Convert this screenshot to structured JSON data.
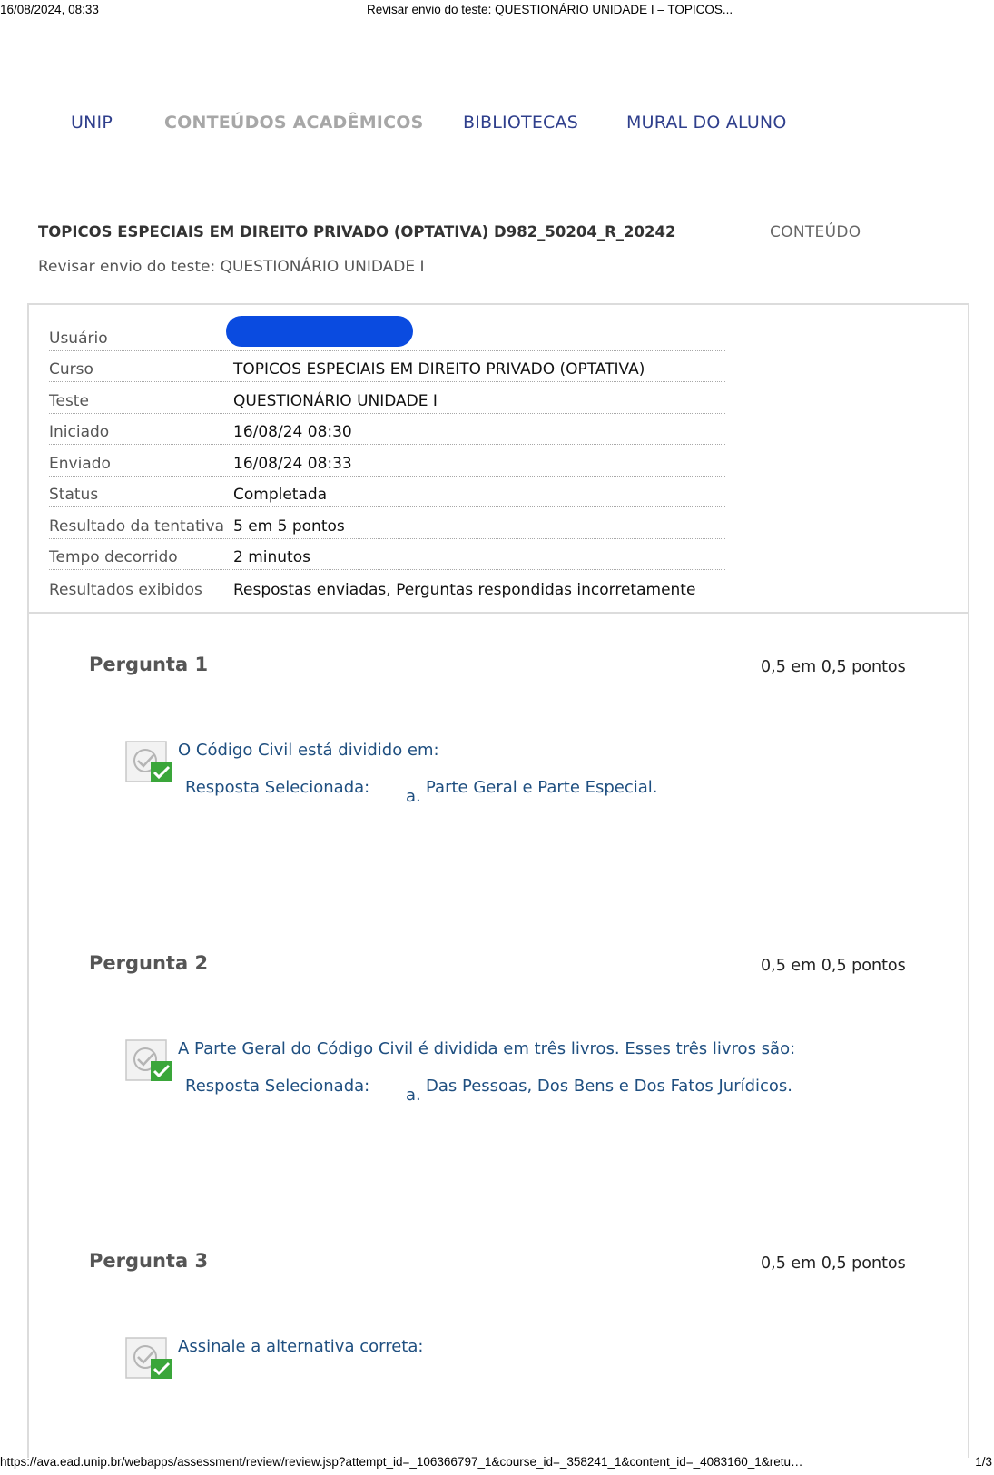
{
  "print_header": {
    "datetime": "16/08/2024, 08:33",
    "doc_title": "Revisar envio do teste: QUESTIONÁRIO UNIDADE I – TOPICOS..."
  },
  "nav": {
    "items": [
      {
        "label": "UNIP"
      },
      {
        "label": "CONTEÚDOS ACADÊMICOS"
      },
      {
        "label": "BIBLIOTECAS"
      },
      {
        "label": "MURAL DO ALUNO"
      }
    ]
  },
  "course": {
    "title": "TOPICOS ESPECIAIS EM DIREITO PRIVADO (OPTATIVA) D982_50204_R_20242",
    "content_link": "CONTEÚDO",
    "breadcrumb": "Revisar envio do teste: QUESTIONÁRIO UNIDADE I"
  },
  "summary": {
    "rows": [
      {
        "label": "Usuário",
        "value": ""
      },
      {
        "label": "Curso",
        "value": "TOPICOS ESPECIAIS EM DIREITO PRIVADO (OPTATIVA)"
      },
      {
        "label": "Teste",
        "value": "QUESTIONÁRIO UNIDADE I"
      },
      {
        "label": "Iniciado",
        "value": "16/08/24 08:30"
      },
      {
        "label": "Enviado",
        "value": "16/08/24 08:33"
      },
      {
        "label": "Status",
        "value": "Completada"
      },
      {
        "label": "Resultado da tentativa",
        "value": "5 em 5 pontos"
      },
      {
        "label": "Tempo decorrido",
        "value": "2 minutos"
      },
      {
        "label": "Resultados exibidos",
        "value": "Respostas enviadas, Perguntas respondidas incorretamente"
      }
    ]
  },
  "questions": [
    {
      "title": "Pergunta 1",
      "points": "0,5 em 0,5 pontos",
      "text": "O Código Civil está dividido em:",
      "answer_label": "Resposta Selecionada:",
      "answer_letter": "a.",
      "answer_text": "Parte Geral e Parte Especial."
    },
    {
      "title": "Pergunta 2",
      "points": "0,5 em 0,5 pontos",
      "text": "A Parte Geral do Código Civil é dividida em três livros. Esses três livros são:",
      "answer_label": "Resposta Selecionada:",
      "answer_letter": "a.",
      "answer_text": "Das Pessoas, Dos Bens e Dos Fatos Jurídicos."
    },
    {
      "title": "Pergunta 3",
      "points": "0,5 em 0,5 pontos",
      "text": "Assinale a alternativa correta:"
    }
  ],
  "print_footer": {
    "url": "https://ava.ead.unip.br/webapps/assessment/review/review.jsp?attempt_id=_106366797_1&course_id=_358241_1&content_id=_4083160_1&retu…",
    "page": "1/3"
  },
  "colors": {
    "nav_link": "#2f3f8c",
    "nav_muted": "#a7a7a7",
    "question_text": "#1f4f80",
    "redaction": "#0a4be0",
    "check_green": "#3aa63a"
  }
}
